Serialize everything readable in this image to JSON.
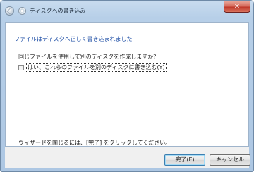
{
  "window": {
    "title": "ディスクへの書き込み",
    "close_symbol": "✕"
  },
  "main": {
    "heading": "ファイルはディスクへ正しく書き込まれました",
    "question": "同じファイルを使用して別のディスクを作成しますか?",
    "option": {
      "label": "はい、これらのファイルを別のディスクに書き込む(Y)",
      "checked": false
    },
    "hint": "ウィザードを閉じるには、[完了] をクリックしてください。"
  },
  "buttons": {
    "finish": "完了(E)",
    "cancel": "キャンセル"
  },
  "icons": {
    "back": "back-arrow-icon",
    "disc": "disc-icon",
    "close": "close-icon"
  },
  "colors": {
    "heading": "#1f4fa6",
    "close_button": "#c0392b",
    "title_gradient": "#c9dcef"
  }
}
